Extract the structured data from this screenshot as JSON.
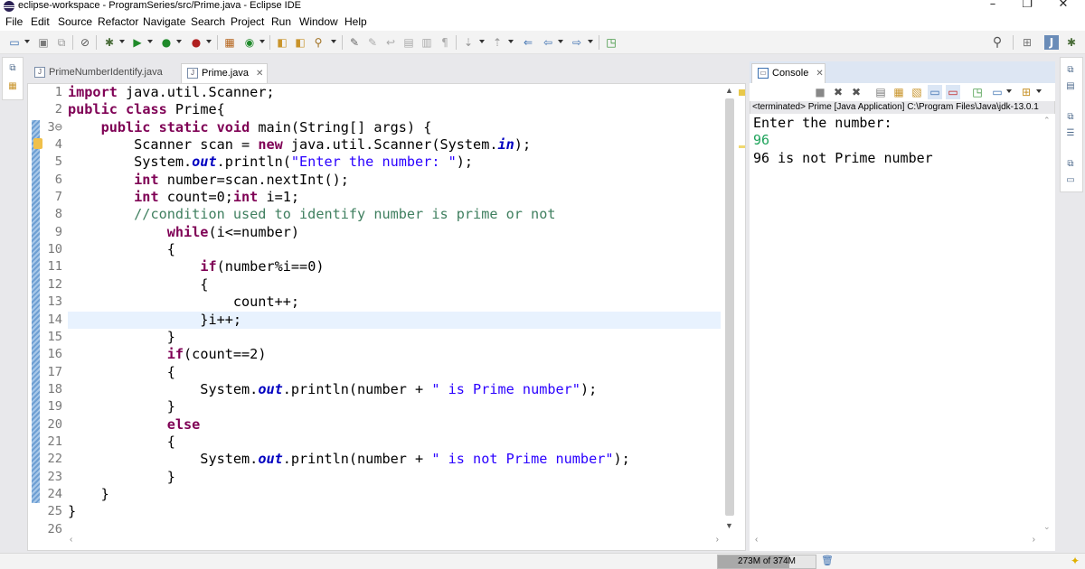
{
  "window": {
    "title": "eclipse-workspace - ProgramSeries/src/Prime.java - Eclipse IDE",
    "minimize_glyph": "–",
    "restore_glyph": "❐",
    "close_glyph": "✕"
  },
  "menu": [
    "File",
    "Edit",
    "Source",
    "Refactor",
    "Navigate",
    "Search",
    "Project",
    "Run",
    "Window",
    "Help"
  ],
  "toolbar_icons": [
    "new-icon",
    "save-icon",
    "save-all-icon",
    "skip-breakpoints-icon",
    "debug-icon",
    "run-icon",
    "coverage-icon",
    "external-tools-icon",
    "new-java-project-icon",
    "new-class-icon",
    "open-type-icon",
    "open-task-icon",
    "search-icon",
    "annotation-icon",
    "next-annotation-icon",
    "toggle-word-wrap-icon",
    "block-selection-icon",
    "show-whitespace-icon",
    "next-edit-icon",
    "prev-edit-icon",
    "back-icon",
    "forward-icon",
    "pin-editor-icon"
  ],
  "perspective": {
    "search_glyph": "⚲",
    "open_perspective_glyph": "⊞",
    "java_glyph": "J",
    "debug_glyph": "✱"
  },
  "editor": {
    "tabs": [
      {
        "label": "PrimeNumberIdentify.java",
        "active": false
      },
      {
        "label": "Prime.java",
        "active": true,
        "close": "✕"
      }
    ],
    "line_numbers": [
      "1",
      "2",
      "3⊖",
      "4",
      "5",
      "6",
      "7",
      "8",
      "9",
      "10",
      "11",
      "12",
      "13",
      "14",
      "15",
      "16",
      "17",
      "18",
      "19",
      "20",
      "21",
      "22",
      "23",
      "24",
      "25",
      "26"
    ],
    "current_line": 14,
    "lines": [
      "import java.util.Scanner;",
      "public class Prime{",
      "    public static void main(String[] args) {",
      "        Scanner scan = new java.util.Scanner(System.in);",
      "        System.out.println(\"Enter the number: \");",
      "        int number=scan.nextInt();",
      "        int count=0;int i=1;",
      "        //condition used to identify number is prime or not",
      "            while(i<=number)",
      "            {",
      "                if(number%i==0)",
      "                {",
      "                    count++;",
      "                }i++;",
      "            }",
      "            if(count==2)",
      "            {",
      "                System.out.println(number + \" is Prime number\");",
      "            }",
      "            else",
      "            {",
      "                System.out.println(number + \" is not Prime number\");",
      "            }",
      "    }",
      "}",
      ""
    ]
  },
  "console": {
    "tab_label": "Console",
    "tab_close": "✕",
    "status": "<terminated> Prime [Java Application] C:\\Program Files\\Java\\jdk-13.0.1",
    "output": [
      {
        "text": "Enter the number:",
        "color": "#000000"
      },
      {
        "text": "96",
        "color": "#1ea35b"
      },
      {
        "text": "96 is not Prime number",
        "color": "#000000"
      }
    ]
  },
  "statusbar": {
    "heap": "273M of 374M",
    "heap_used_fraction": 0.73
  },
  "colors": {
    "keyword": "#7f0055",
    "string": "#2a00ff",
    "comment": "#3f7f5f",
    "field": "#0000c0",
    "input_echo": "#1ea35b"
  }
}
